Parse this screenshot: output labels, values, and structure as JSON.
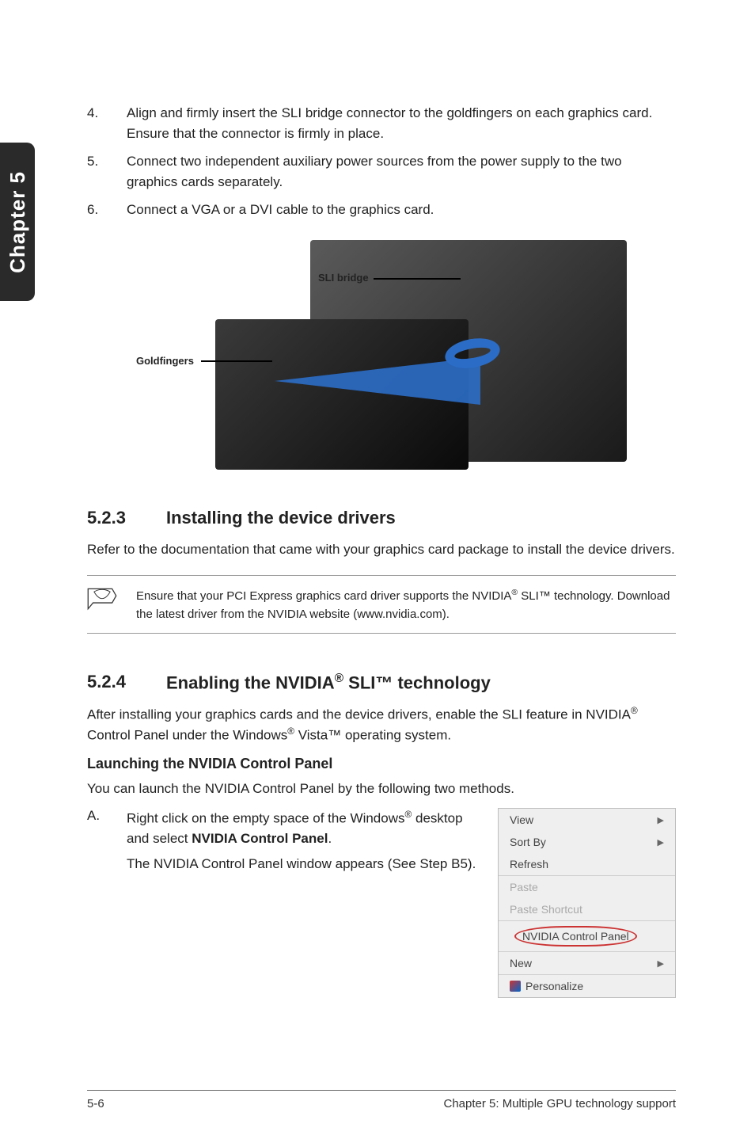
{
  "chapterTab": "Chapter 5",
  "install": {
    "items": [
      {
        "num": "4.",
        "text": "Align and firmly insert the SLI bridge connector to the goldfingers on each graphics card. Ensure that the connector is firmly in place."
      },
      {
        "num": "5.",
        "text": "Connect two independent auxiliary power sources from the power supply to the two graphics cards separately."
      },
      {
        "num": "6.",
        "text": "Connect a VGA or a DVI cable to the graphics card."
      }
    ]
  },
  "figure": {
    "callout_sli": "SLI bridge",
    "callout_gold": "Goldfingers"
  },
  "sec523": {
    "num": "5.2.3",
    "title": "Installing the device drivers",
    "intro": "Refer to the documentation that came with your graphics card package to install the device drivers.",
    "note_pre": "Ensure that your PCI Express graphics card driver supports the NVIDIA",
    "note_sup": "®",
    "note_post": " SLI™ technology. Download the latest driver from the NVIDIA website (www.nvidia.com)."
  },
  "sec524": {
    "num": "5.2.4",
    "title_pre": "Enabling the NVIDIA",
    "title_sup": "®",
    "title_post": " SLI™ technology",
    "intro_pre": "After installing your graphics cards and the device drivers, enable the SLI feature in NVIDIA",
    "intro_sup1": "®",
    "intro_mid": " Control Panel under the Windows",
    "intro_sup2": "®",
    "intro_post": " Vista™ operating system.",
    "subheading": "Launching the NVIDIA Control Panel",
    "subintro": "You can launch the NVIDIA Control Panel by the following two methods.",
    "stepA": {
      "num": "A.",
      "line1_pre": "Right click on the empty space of the Windows",
      "line1_sup": "®",
      "line1_post": " desktop and select ",
      "line1_bold": "NVIDIA Control Panel",
      "line1_end": ".",
      "line2": "The NVIDIA Control Panel window appears (See Step B5)."
    }
  },
  "contextmenu": {
    "view": "View",
    "sortby": "Sort By",
    "refresh": "Refresh",
    "paste": "Paste",
    "pasteShortcut": "Paste Shortcut",
    "nvidia": "NVIDIA Control Panel",
    "new": "New",
    "personalize": "Personalize"
  },
  "footer": {
    "left": "5-6",
    "right": "Chapter 5: Multiple GPU technology support"
  }
}
